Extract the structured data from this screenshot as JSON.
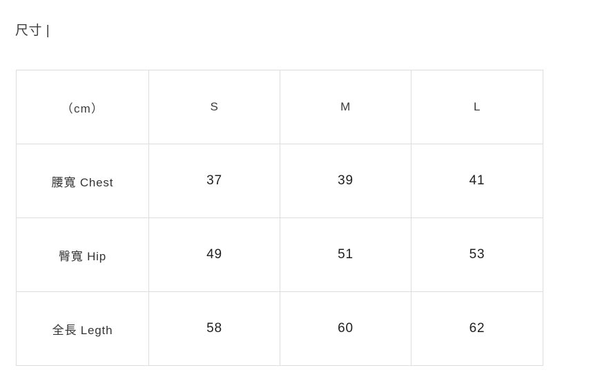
{
  "section": {
    "title": "尺寸 |"
  },
  "size_table": {
    "columns": [
      "（cm）",
      "S",
      "M",
      "L"
    ],
    "rows": [
      {
        "label": "腰寬 Chest",
        "values": [
          "37",
          "39",
          "41"
        ]
      },
      {
        "label": "臀寬 Hip",
        "values": [
          "49",
          "51",
          "53"
        ]
      },
      {
        "label": "全長 Legth",
        "values": [
          "58",
          "60",
          "62"
        ]
      }
    ],
    "colors": {
      "border": "#dddddd",
      "background": "#ffffff",
      "label_text": "#333333",
      "value_text": "#1f1f1f",
      "title_text": "#3d3d3d"
    }
  }
}
